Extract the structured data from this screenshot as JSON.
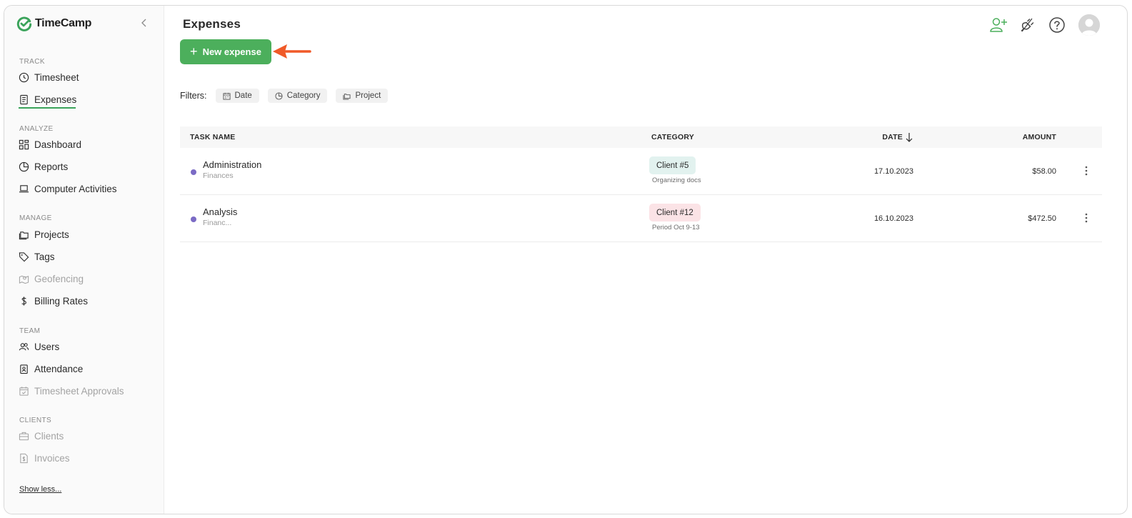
{
  "app": {
    "name": "TimeCamp"
  },
  "sidebar": {
    "sections": [
      {
        "label": "TRACK"
      },
      {
        "label": "ANALYZE"
      },
      {
        "label": "MANAGE"
      },
      {
        "label": "TEAM"
      },
      {
        "label": "CLIENTS"
      }
    ],
    "items": {
      "timesheet": "Timesheet",
      "expenses": "Expenses",
      "dashboard": "Dashboard",
      "reports": "Reports",
      "computer_activities": "Computer Activities",
      "projects": "Projects",
      "tags": "Tags",
      "geofencing": "Geofencing",
      "billing_rates": "Billing Rates",
      "users": "Users",
      "attendance": "Attendance",
      "timesheet_approvals": "Timesheet Approvals",
      "clients": "Clients",
      "invoices": "Invoices"
    },
    "show_less": "Show less..."
  },
  "header": {
    "title": "Expenses",
    "new_expense_label": "New expense",
    "icons": [
      "add-user-icon",
      "integrations-plug-icon",
      "help-icon",
      "user-avatar"
    ]
  },
  "filters": {
    "label": "Filters:",
    "chips": [
      "Date",
      "Category",
      "Project"
    ]
  },
  "table": {
    "columns": {
      "task": "TASK NAME",
      "category": "CATEGORY",
      "date": "DATE",
      "amount": "AMOUNT"
    },
    "sort": {
      "column": "DATE",
      "direction": "descending"
    },
    "rows": [
      {
        "task": "Administration",
        "sub": "Finances",
        "category": "Client #5",
        "category_note": "Organizing docs",
        "category_color": "#e2f2ef",
        "date": "17.10.2023",
        "amount": "$58.00"
      },
      {
        "task": "Analysis",
        "sub": "Financ...",
        "category": "Client #12",
        "category_note": "Period Oct 9-13",
        "category_color": "#fbe3e6",
        "date": "16.10.2023",
        "amount": "$472.50"
      }
    ]
  },
  "colors": {
    "brand_green": "#4caf5c",
    "annotation_arrow": "#f05a28",
    "task_dot": "#7b6bc5"
  }
}
